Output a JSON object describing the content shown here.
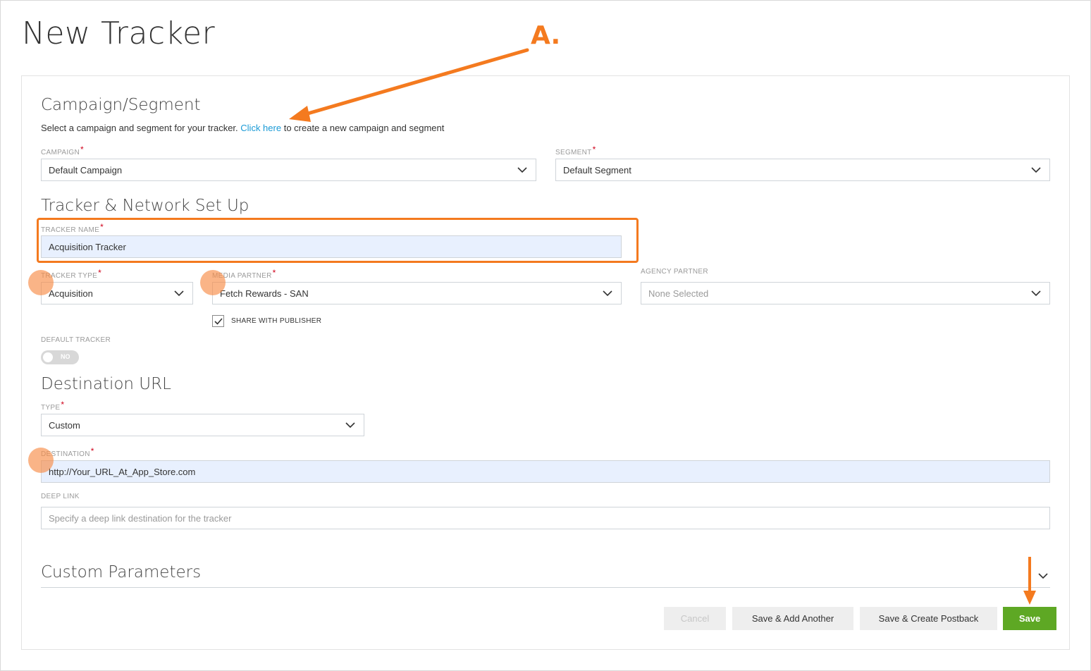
{
  "page": {
    "title": "New Tracker"
  },
  "campaign_section": {
    "title": "Campaign/Segment",
    "helper_prefix": "Select a campaign and segment for your tracker.",
    "helper_link": "Click here",
    "helper_suffix": "to create a new campaign and segment",
    "campaign_label": "CAMPAIGN",
    "campaign_value": "Default Campaign",
    "segment_label": "SEGMENT",
    "segment_value": "Default Segment"
  },
  "tracker_section": {
    "title": "Tracker & Network Set Up",
    "name_label": "TRACKER NAME",
    "name_value": "Acquisition Tracker",
    "type_label": "TRACKER TYPE",
    "type_value": "Acquisition",
    "media_label": "MEDIA PARTNER",
    "media_value": "Fetch Rewards - SAN",
    "agency_label": "AGENCY PARTNER",
    "agency_placeholder": "None Selected",
    "share_label": "SHARE WITH PUBLISHER",
    "share_checked": true,
    "default_label": "DEFAULT TRACKER",
    "default_toggle_text": "NO"
  },
  "destination_section": {
    "title": "Destination URL",
    "type_label": "TYPE",
    "type_value": "Custom",
    "destination_label": "DESTINATION",
    "destination_value": "http://Your_URL_At_App_Store.com",
    "deeplink_label": "DEEP LINK",
    "deeplink_placeholder": "Specify a deep link destination for the tracker"
  },
  "custom_params": {
    "title": "Custom Parameters"
  },
  "actions": {
    "cancel": "Cancel",
    "save_add": "Save & Add Another",
    "save_postback": "Save & Create Postback",
    "save": "Save"
  },
  "annotation": {
    "letter": "A.",
    "color": "#f47a1f"
  },
  "colors": {
    "link": "#1a9ad6",
    "save": "#5ea824",
    "required": "#d0021b"
  }
}
